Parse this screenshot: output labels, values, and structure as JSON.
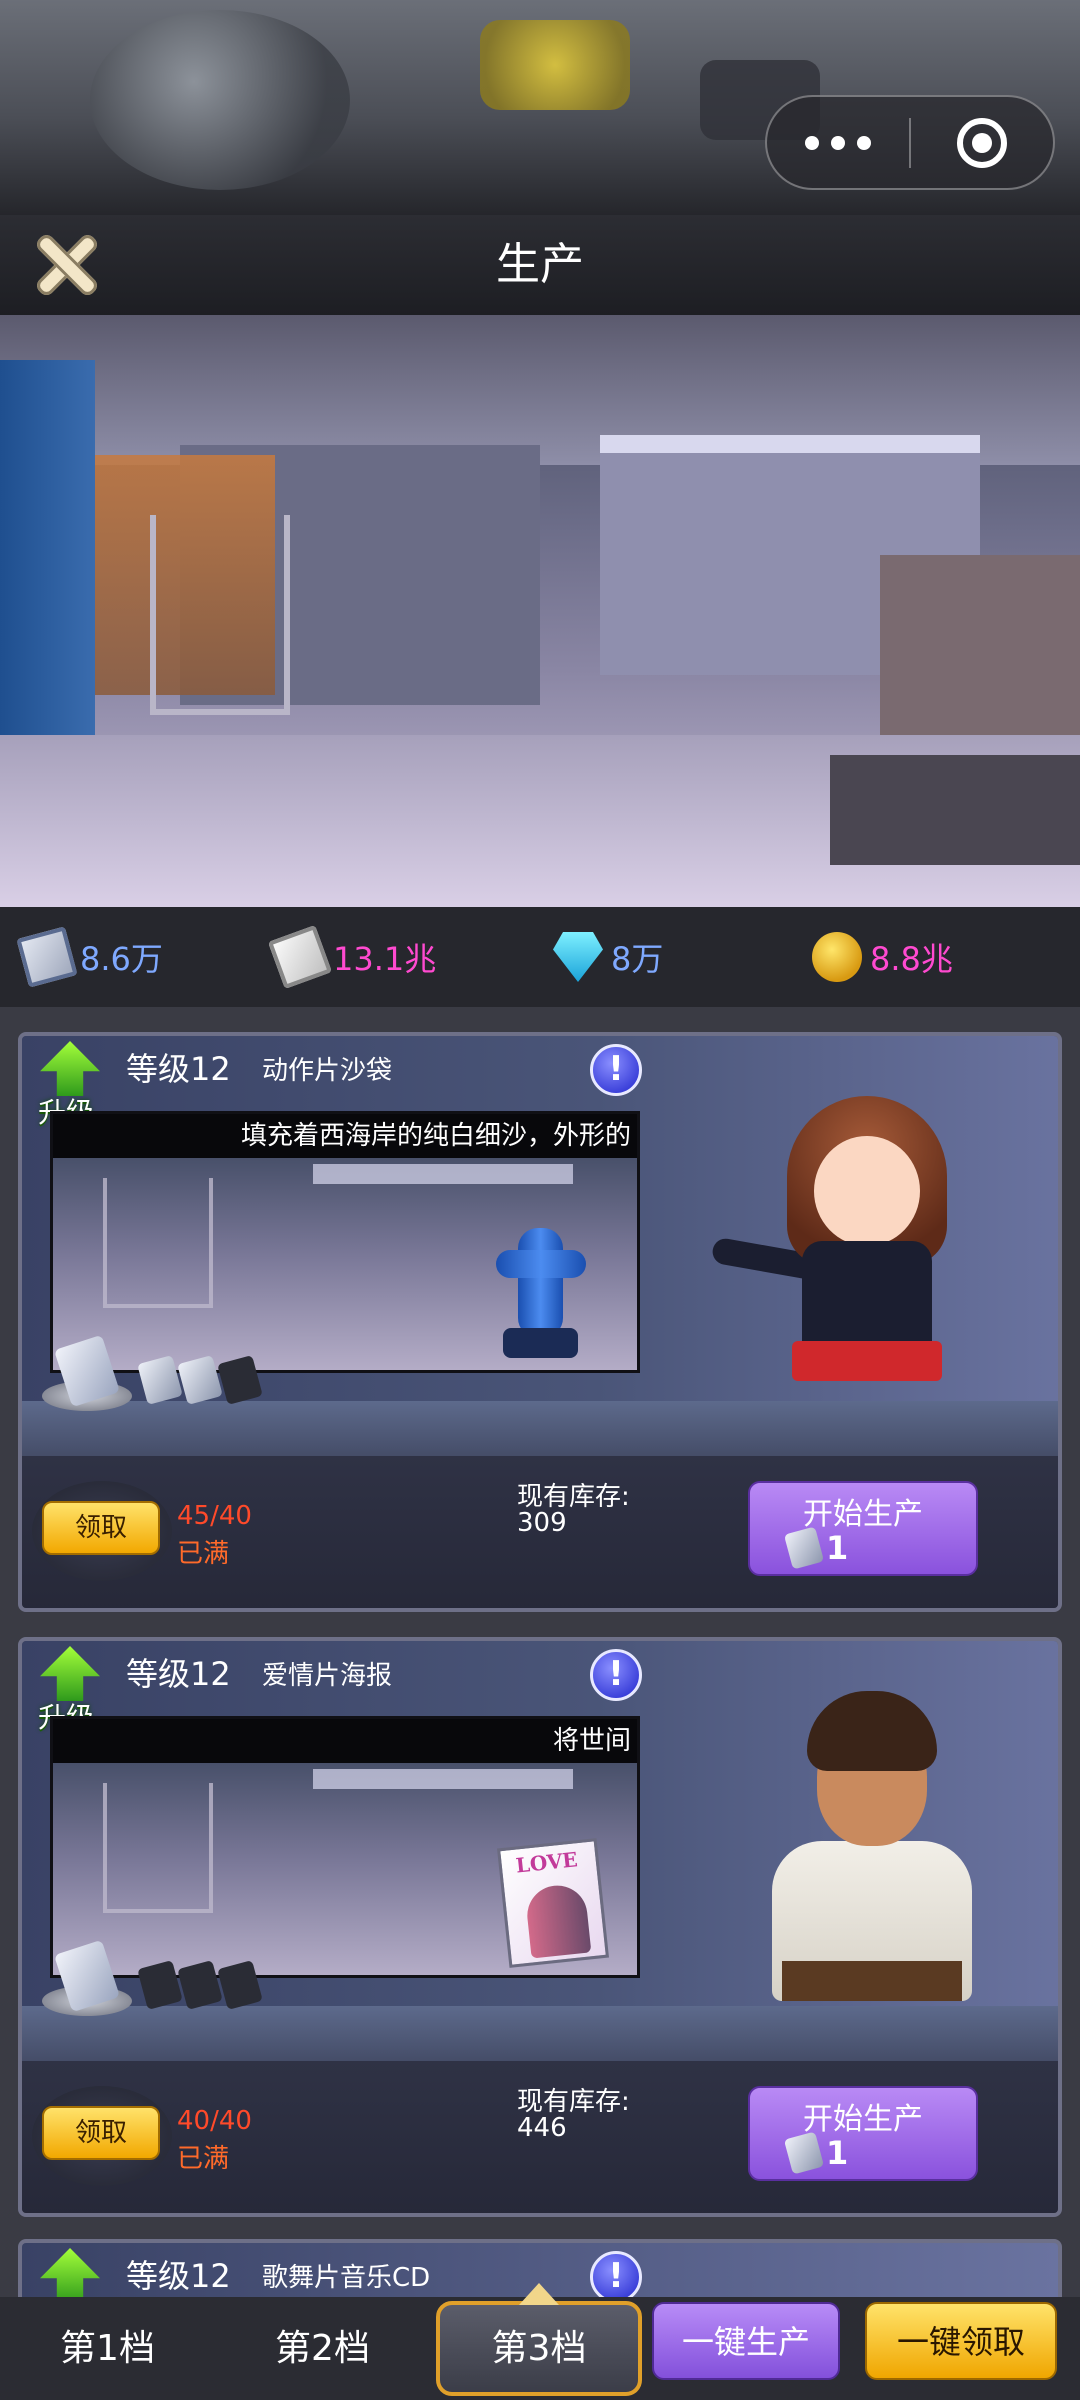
{
  "window": {
    "title": "生产",
    "capsule": {
      "more_icon": "more-dots-icon",
      "close_icon": "target-circle-icon"
    }
  },
  "resources": [
    {
      "name": "scroll",
      "icon": "blueprint-scroll-icon",
      "value": "8.6万",
      "color": "#7fa9ff"
    },
    {
      "name": "cash",
      "icon": "cash-stack-icon",
      "value": "13.1兆",
      "color": "#ff4ad0"
    },
    {
      "name": "diamond",
      "icon": "diamond-icon",
      "value": "8万",
      "color": "#7fa9ff"
    },
    {
      "name": "gold",
      "icon": "gold-coins-icon",
      "value": "8.8兆",
      "color": "#ff4ad0"
    }
  ],
  "cards": [
    {
      "upgrade_label": "升级",
      "level": "等级12",
      "product": "动作片沙袋",
      "description": "填充着西海岸的纯白细沙，外形的",
      "scroll_slots": [
        true,
        true,
        false
      ],
      "claim_label": "领取",
      "count": "45/40",
      "full_label": "已满",
      "stock_label": "现有库存:",
      "stock_value": "309",
      "start_label": "开始生产",
      "cost": "1"
    },
    {
      "upgrade_label": "升级",
      "level": "等级12",
      "product": "爱情片海报",
      "description": "将世间",
      "scroll_slots": [
        false,
        false,
        false
      ],
      "claim_label": "领取",
      "count": "40/40",
      "full_label": "已满",
      "stock_label": "现有库存:",
      "stock_value": "446",
      "start_label": "开始生产",
      "cost": "1"
    },
    {
      "upgrade_label": "升级",
      "level": "等级12",
      "product": "歌舞片音乐CD"
    }
  ],
  "tabs": [
    {
      "label": "第1档"
    },
    {
      "label": "第2档"
    },
    {
      "label": "第3档",
      "selected": true
    }
  ],
  "actions": {
    "produce_all": "一键生产",
    "claim_all": "一键领取"
  }
}
